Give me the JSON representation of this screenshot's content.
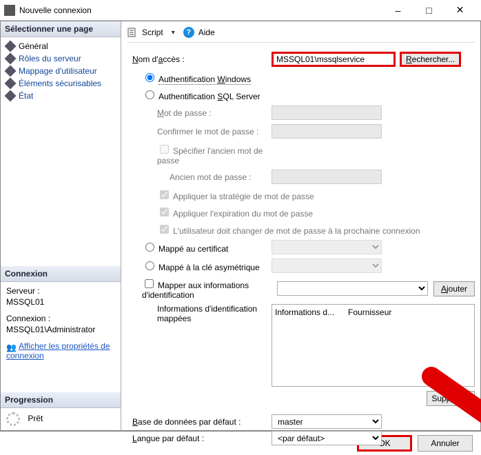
{
  "window": {
    "title": "Nouvelle connexion"
  },
  "sidebar": {
    "select_page": "Sélectionner une page",
    "pages": [
      {
        "label": "Général"
      },
      {
        "label": "Rôles du serveur"
      },
      {
        "label": "Mappage d'utilisateur"
      },
      {
        "label": "Éléments sécurisables"
      },
      {
        "label": "État"
      }
    ],
    "connexion_head": "Connexion",
    "server_label": "Serveur :",
    "server_value": "MSSQL01",
    "conn_label": "Connexion :",
    "conn_value": "MSSQL01\\Administrator",
    "view_props": "Afficher les propriétés de connexion",
    "progress_head": "Progression",
    "status": "Prêt"
  },
  "toolbar": {
    "script": "Script",
    "help": "Aide"
  },
  "form": {
    "login_label": "Nom d'accès :",
    "login_value": "MSSQL01\\mssqlservice",
    "search": "Rechercher...",
    "auth_win": "Authentification Windows",
    "auth_sql": "Authentification SQL Server",
    "password": "Mot de passe :",
    "confirm_pw": "Confirmer le mot de passe :",
    "specify_old": "Spécifier l'ancien mot de passe",
    "old_pw": "Ancien mot de passe :",
    "enforce_policy": "Appliquer la stratégie de mot de passe",
    "enforce_expiry": "Appliquer l'expiration du mot de passe",
    "must_change": "L'utilisateur doit changer de mot de passe à la prochaine connexion",
    "mapped_cert": "Mappé au certificat",
    "mapped_key": "Mappé à la clé asymétrique",
    "map_creds": "Mapper aux informations d'identification",
    "add": "Ajouter",
    "mapped_label": "Informations d'identification mappées",
    "col1": "Informations d...",
    "col2": "Fournisseur",
    "remove": "Supprimer",
    "default_db_label": "Base de données par défaut :",
    "default_db": "master",
    "default_lang_label": "Langue par défaut :",
    "default_lang": "<par défaut>"
  },
  "footer": {
    "ok": "OK",
    "cancel": "Annuler"
  }
}
